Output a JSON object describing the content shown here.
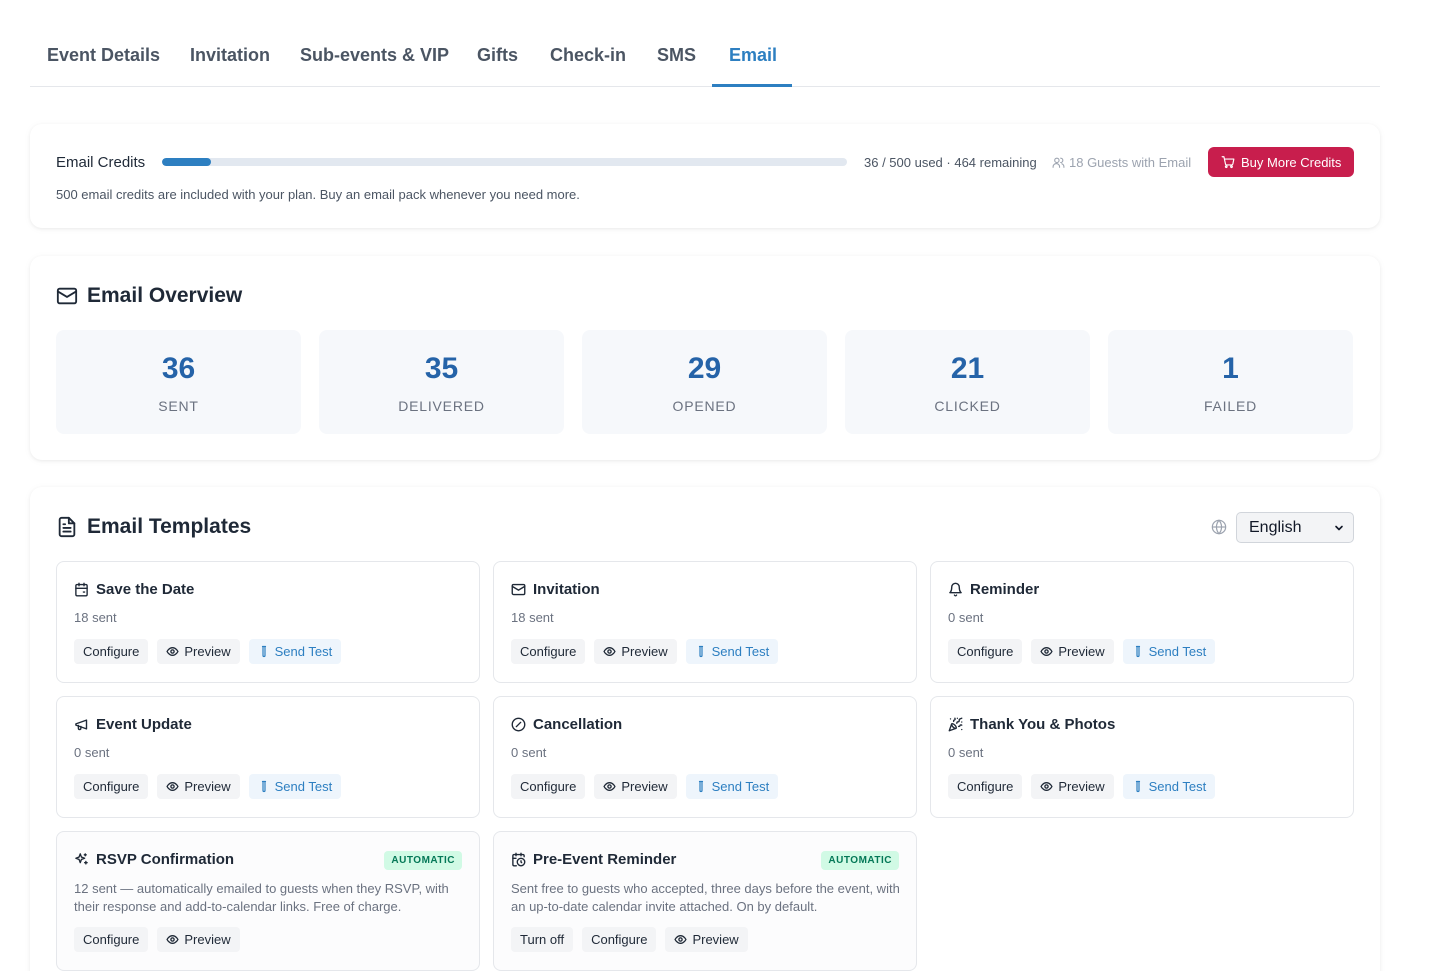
{
  "tabs": [
    {
      "label": "Event Details"
    },
    {
      "label": "Invitation"
    },
    {
      "label": "Sub-events & VIP"
    },
    {
      "label": "Gifts"
    },
    {
      "label": "Check-in"
    },
    {
      "label": "SMS"
    },
    {
      "label": "Email"
    }
  ],
  "active_tab": "Email",
  "accent_color": "#2d7fc1",
  "credits": {
    "title": "Email Credits",
    "used": 36,
    "total": 500,
    "progress_fraction": 0.072,
    "usage_text": "36 / 500 used · 464 remaining",
    "guests_text": "18 Guests with Email",
    "buy_label": "Buy More Credits",
    "buy_color": "#c81e4d",
    "note": "500 email credits are included with your plan. Buy an email pack whenever you need more."
  },
  "overview": {
    "title": "Email Overview",
    "stats": [
      {
        "value": "36",
        "label": "SENT"
      },
      {
        "value": "35",
        "label": "DELIVERED"
      },
      {
        "value": "29",
        "label": "OPENED"
      },
      {
        "value": "21",
        "label": "CLICKED"
      },
      {
        "value": "1",
        "label": "FAILED"
      }
    ]
  },
  "templates": {
    "title": "Email Templates",
    "language": "English",
    "items": [
      {
        "name": "Save the Date",
        "icon": "calendar-icon",
        "meta": "18 sent",
        "actions": {
          "configure": "Configure",
          "preview": "Preview",
          "test": "Send Test"
        }
      },
      {
        "name": "Invitation",
        "icon": "mail-icon",
        "meta": "18 sent",
        "actions": {
          "configure": "Configure",
          "preview": "Preview",
          "test": "Send Test"
        }
      },
      {
        "name": "Reminder",
        "icon": "bell-icon",
        "meta": "0 sent",
        "actions": {
          "configure": "Configure",
          "preview": "Preview",
          "test": "Send Test"
        }
      },
      {
        "name": "Event Update",
        "icon": "megaphone-icon",
        "meta": "0 sent",
        "actions": {
          "configure": "Configure",
          "preview": "Preview",
          "test": "Send Test"
        }
      },
      {
        "name": "Cancellation",
        "icon": "ban-icon",
        "meta": "0 sent",
        "actions": {
          "configure": "Configure",
          "preview": "Preview",
          "test": "Send Test"
        }
      },
      {
        "name": "Thank You & Photos",
        "icon": "party-popper-icon",
        "meta": "0 sent",
        "actions": {
          "configure": "Configure",
          "preview": "Preview",
          "test": "Send Test"
        }
      },
      {
        "name": "RSVP Confirmation",
        "icon": "sparkles-icon",
        "badge": "AUTOMATIC",
        "desc": "12 sent — automatically emailed to guests when they RSVP, with their response and add-to-calendar links. Free of charge.",
        "actions": {
          "configure": "Configure",
          "preview": "Preview"
        }
      },
      {
        "name": "Pre-Event Reminder",
        "icon": "calendar-clock-icon",
        "badge": "AUTOMATIC",
        "desc": "Sent free to guests who accepted, three days before the event, with an up-to-date calendar invite attached. On by default.",
        "actions": {
          "turn_off": "Turn off",
          "configure": "Configure",
          "preview": "Preview"
        }
      }
    ]
  }
}
